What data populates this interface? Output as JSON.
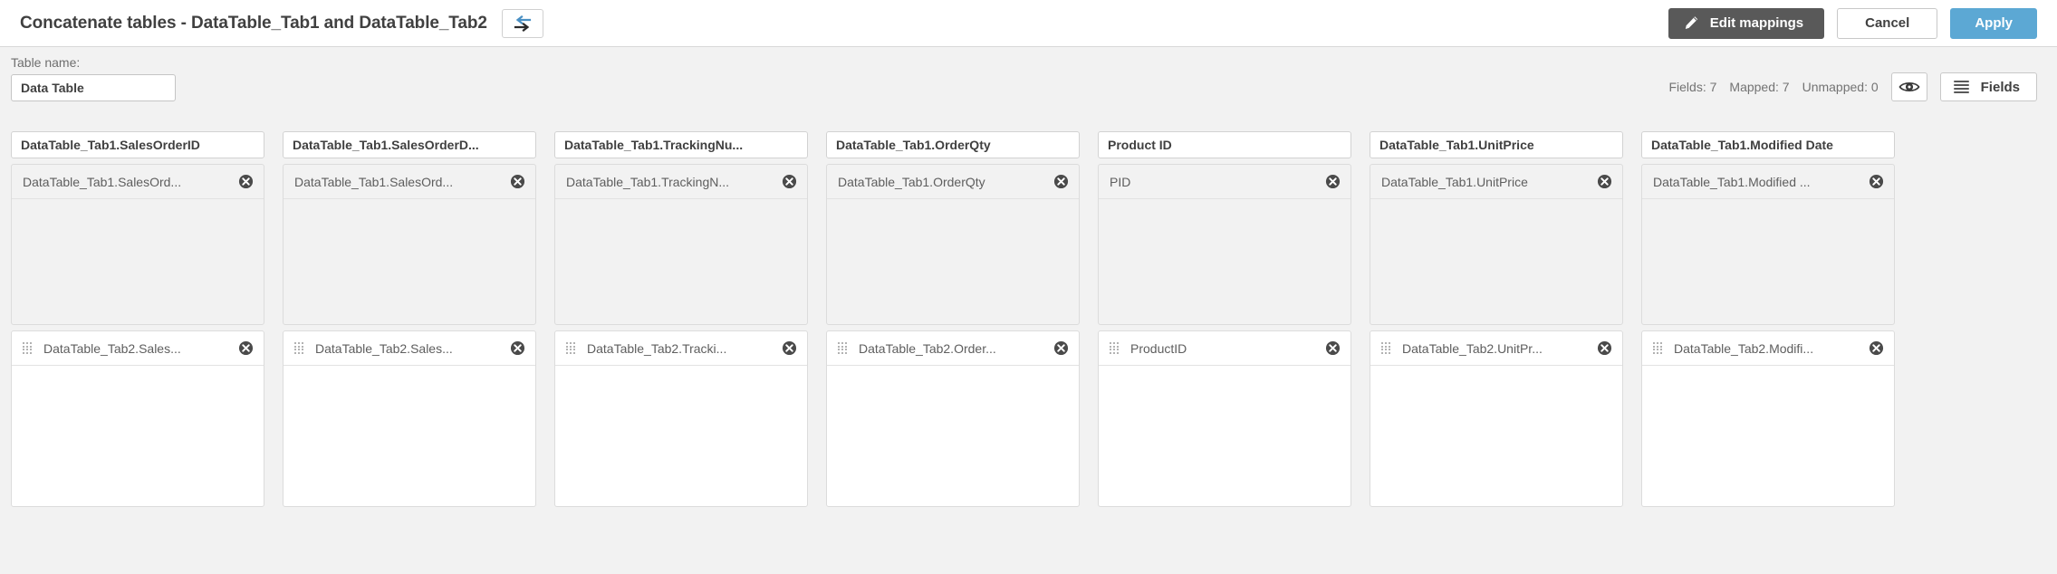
{
  "header": {
    "title": "Concatenate tables - DataTable_Tab1 and DataTable_Tab2",
    "swap_icon": "swap-arrows-icon",
    "edit_mappings_label": "Edit mappings",
    "edit_mappings_icon": "pencil-icon",
    "cancel_label": "Cancel",
    "apply_label": "Apply",
    "colors": {
      "apply": "#5ca8d4",
      "edit_mappings": "#595959"
    }
  },
  "table_name": {
    "label": "Table name:",
    "value": "Data Table",
    "placeholder": "Table name"
  },
  "stats": {
    "fields": "Fields: 7",
    "mapped": "Mapped: 7",
    "unmapped": "Unmapped: 0",
    "preview_icon": "eye-icon",
    "fields_button_label": "Fields",
    "fields_button_icon": "list-icon"
  },
  "columns": [
    {
      "header": "DataTable_Tab1.SalesOrderID",
      "top_chip": "DataTable_Tab1.SalesOrd...",
      "bottom_chip": "DataTable_Tab2.Sales..."
    },
    {
      "header": "DataTable_Tab1.SalesOrderD...",
      "top_chip": "DataTable_Tab1.SalesOrd...",
      "bottom_chip": "DataTable_Tab2.Sales..."
    },
    {
      "header": "DataTable_Tab1.TrackingNu...",
      "top_chip": "DataTable_Tab1.TrackingN...",
      "bottom_chip": "DataTable_Tab2.Tracki..."
    },
    {
      "header": "DataTable_Tab1.OrderQty",
      "top_chip": "DataTable_Tab1.OrderQty",
      "bottom_chip": "DataTable_Tab2.Order..."
    },
    {
      "header": "Product ID",
      "top_chip": "PID",
      "bottom_chip": "ProductID"
    },
    {
      "header": "DataTable_Tab1.UnitPrice",
      "top_chip": "DataTable_Tab1.UnitPrice",
      "bottom_chip": "DataTable_Tab2.UnitPr..."
    },
    {
      "header": "DataTable_Tab1.Modified Date",
      "top_chip": "DataTable_Tab1.Modified ...",
      "bottom_chip": "DataTable_Tab2.Modifi..."
    }
  ],
  "icons": {
    "remove": "remove-circle-icon",
    "drag": "drag-handle-icon"
  }
}
